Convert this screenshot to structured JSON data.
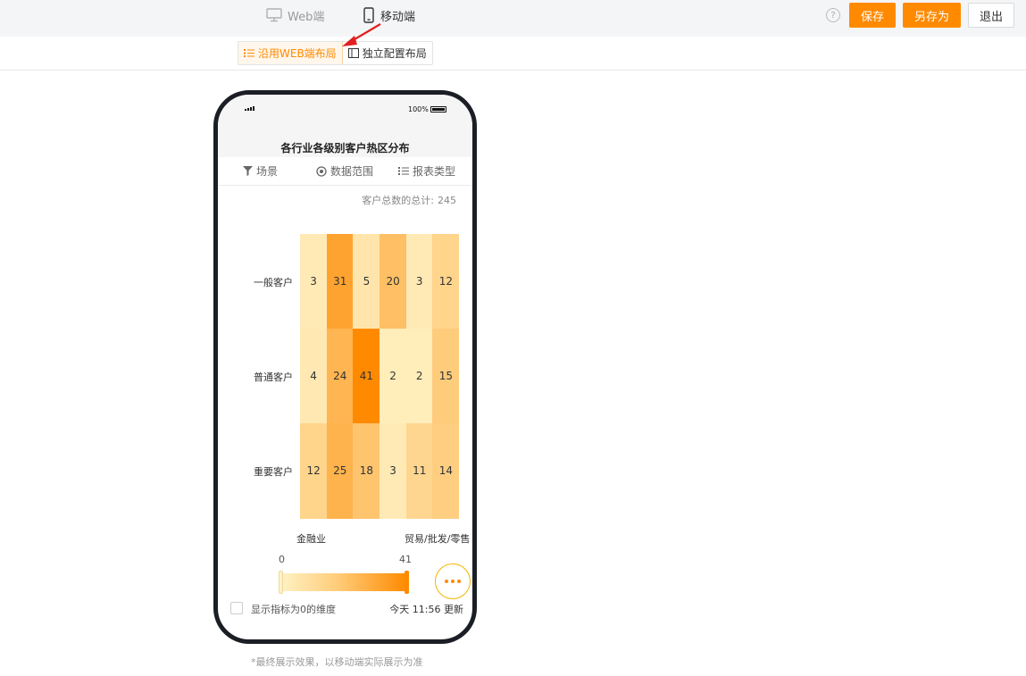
{
  "topbar": {
    "tab_web": "Web端",
    "tab_mobile": "移动端",
    "help_glyph": "?",
    "save_label": "保存",
    "save_as_label": "另存为",
    "exit_label": "退出"
  },
  "layout_tabs": {
    "follow_web": "沿用WEB端布局",
    "independent": "独立配置布局"
  },
  "phone": {
    "battery": "100%",
    "report_title": "各行业各级别客户热区分布",
    "tools": {
      "scene": "场景",
      "range": "数据范围",
      "type": "报表类型"
    },
    "total_label": "客户总数的总计:",
    "total_value": "245",
    "legend": {
      "min": "0",
      "max": "41"
    },
    "show_zero_label": "显示指标为0的维度",
    "update_text": "今天 11:56 更新"
  },
  "chart_data": {
    "type": "heatmap",
    "rows": [
      "一般客户",
      "普通客户",
      "重要客户"
    ],
    "x_labels": [
      "金融业",
      "贸易/批发/零售"
    ],
    "values": [
      [
        3,
        31,
        5,
        20,
        3,
        12
      ],
      [
        4,
        24,
        41,
        2,
        2,
        15
      ],
      [
        12,
        25,
        18,
        3,
        11,
        14
      ]
    ],
    "value_range": [
      0,
      41
    ],
    "color_low": "#fff2c4",
    "color_high": "#ff8a00"
  },
  "footnote": "*最终展示效果，以移动端实际展示为准",
  "colors": {
    "accent": "#ff8a00",
    "arrow": "#e02020"
  }
}
